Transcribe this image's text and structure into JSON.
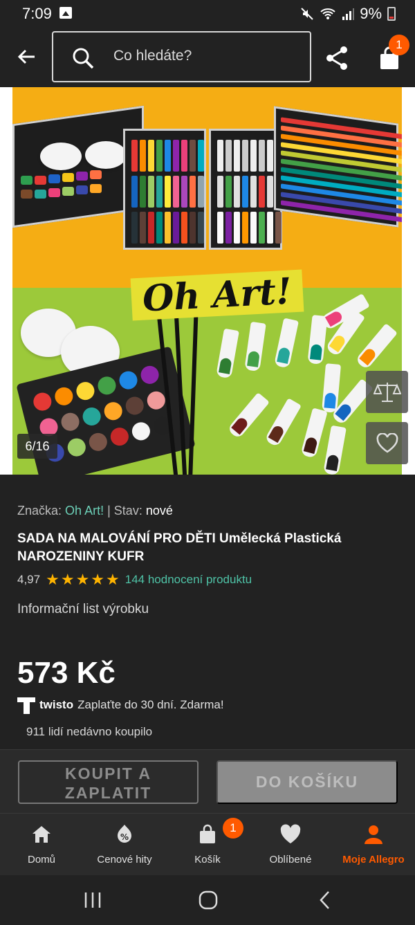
{
  "status_bar": {
    "time": "7:09",
    "battery": "9%"
  },
  "header": {
    "search_placeholder": "Co hledáte?",
    "cart_count": "1"
  },
  "gallery": {
    "counter": "6/16",
    "brand_overlay": "Oh Art!"
  },
  "product": {
    "brand_label": "Značka:",
    "brand": "Oh Art!",
    "separator": "|",
    "condition_label": "Stav:",
    "condition": "nové",
    "title": "SADA NA MALOVÁNÍ PRO DĚTI Umělecká Plastická NAROZENINY KUFR",
    "rating": "4,97",
    "rating_stars": 5,
    "rating_count": "144 hodnocení produktu",
    "info_sheet": "Informační list výrobku",
    "price": "573 Kč",
    "twisto_name": "twisto",
    "twisto_text": "Zaplaťte do 30 dní. Zdarma!",
    "bought": "911 lidí nedávno koupilo"
  },
  "actions": {
    "buy_now": "KOUPIT A ZAPLATIT",
    "add_to_cart": "DO KOŠÍKU"
  },
  "bottom_nav": {
    "items": [
      {
        "label": "Domů",
        "icon": "home-icon"
      },
      {
        "label": "Cenové hity",
        "icon": "price-tag-icon"
      },
      {
        "label": "Košík",
        "icon": "cart-icon",
        "badge": "1"
      },
      {
        "label": "Oblíbené",
        "icon": "heart-icon"
      },
      {
        "label": "Moje Allegro",
        "icon": "user-icon",
        "active": true
      }
    ]
  },
  "colors": {
    "background": "#222222",
    "accent": "#ff5a00",
    "link": "#4fc3a7",
    "star": "#ffb400"
  }
}
